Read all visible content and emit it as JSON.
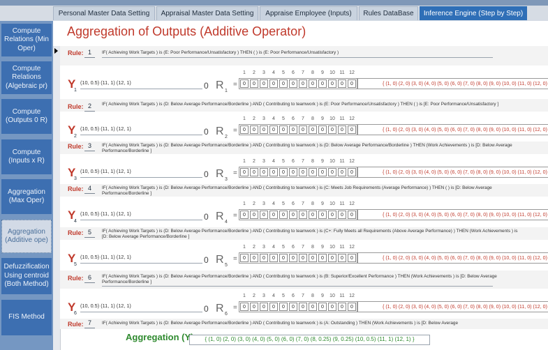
{
  "tabs": [
    {
      "label": "Personal Master Data Setting"
    },
    {
      "label": "Appraisal Master Data Setting"
    },
    {
      "label": "Appraise Employee (Inputs)"
    },
    {
      "label": "Rules DataBase"
    },
    {
      "label": "Inference Engine (Step by Step)",
      "active": true
    }
  ],
  "sidebar": {
    "items": [
      {
        "label": "Compute Relations (Min Oper)"
      },
      {
        "label": "Compute Relations (Algebraic pr)"
      },
      {
        "label": "Compute (Outputs 0 R)"
      },
      {
        "label": "Compute (Inputs x R)"
      },
      {
        "label": "Aggregation (Max Oper)"
      },
      {
        "label": "Aggregation (Additive ope)",
        "active": true
      },
      {
        "label": "Defuzzification Using centroid (Both Method)"
      },
      {
        "label": "FIS Method"
      }
    ]
  },
  "page": {
    "title": "Aggregation of Outputs (Additive Operator)"
  },
  "labels": {
    "rule_keyword": "Rule:",
    "y_letter": "Y",
    "zero_symbol": "0",
    "r_letter": "R",
    "equals": "=",
    "column_numbers": [
      "1",
      "2",
      "3",
      "4",
      "5",
      "6",
      "7",
      "8",
      "9",
      "10",
      "11",
      "12"
    ]
  },
  "rules": [
    {
      "number": "1",
      "text": "IF( Achieving Work Targets ) is (E: Poor Performance/Unsatisfactory ) THEN ( ) is (E: Poor Performance/Unsatisfactory )"
    },
    {
      "number": "2",
      "text": "IF( Achieving Work Targets ) is (D: Below Average Performance/Borderline ) AND ( Contributing to teamwork ) is (E: Poor Performance/Unsatisfactory ) THEN ( ) is [E: Poor Performance/Unsatisfactory ]"
    },
    {
      "number": "3",
      "text": "IF( Achieving Work Targets ) is (D: Below Average Performance/Borderline ) AND ( Contributing to teamwork ) is (D: Below Average Performance/Borderline ) THEN (Work Achievements ) is [D: Below Average Performance/Borderline ]"
    },
    {
      "number": "4",
      "text": "IF( Achieving Work Targets ) is (D: Below Average Performance/Borderline ) AND ( Contributing to teamwork ) is (C: Meets Job Requirements (Average Performance) ) THEN ( ) is [D: Below Average Performance/Borderline ]"
    },
    {
      "number": "5",
      "text": "IF( Achieving Work Targets ) is (D: Below Average Performance/Borderline ) AND ( Contributing to teamwork ) is (C+: Fully Meets all Requirements (Above Average Performance) ) THEN (Work Achievements ) is [D: Below Average Performance/Borderline ]"
    },
    {
      "number": "6",
      "text": "IF( Achieving Work Targets ) is (D: Below Average Performance/Borderline ) AND ( Contributing to teamwork ) is (B: Superior/Excellent Performance ) THEN (Work Achievements ) is [D: Below Average Performance/Borderline ]"
    },
    {
      "number": "7",
      "text": "IF( Achieving Work Targets ) is (D: Below Average Performance/Borderline ) AND ( Contributing to teamwork ) is (A: Outstanding ) THEN (Work Achievements ) is [D: Below Average"
    }
  ],
  "outputs": [
    {
      "sub": "1",
      "y_set": "(10, 0.5) (11, 1) (12, 1)",
      "r_sub": "1",
      "cells": [
        "0",
        "0",
        "0",
        "0",
        "0",
        "0",
        "0",
        "0",
        "0",
        "0",
        "0",
        "0"
      ],
      "result": "{ (1, 0) (2, 0) (3, 0) (4, 0) (5, 0) (6, 0) (7, 0) (8, 0) (9, 0) (10, 0) (11, 0) (12, 0)"
    },
    {
      "sub": "2",
      "y_set": "(10, 0.5) (11, 1) (12, 1)",
      "r_sub": "2",
      "cells": [
        "0",
        "0",
        "0",
        "0",
        "0",
        "0",
        "0",
        "0",
        "0",
        "0",
        "0",
        "0"
      ],
      "result": "{ (1, 0) (2, 0) (3, 0) (4, 0) (5, 0) (6, 0) (7, 0) (8, 0) (9, 0) (10, 0) (11, 0) (12, 0)"
    },
    {
      "sub": "3",
      "y_set": "(10, 0.5) (11, 1) (12, 1)",
      "r_sub": "3",
      "cells": [
        "0",
        "0",
        "0",
        "0",
        "0",
        "0",
        "0",
        "0",
        "0",
        "0",
        "0",
        "0"
      ],
      "result": "{ (1, 0) (2, 0) (3, 0) (4, 0) (5, 0) (6, 0) (7, 0) (8, 0) (9, 0) (10, 0) (11, 0) (12, 0)"
    },
    {
      "sub": "4",
      "y_set": "(10, 0.5) (11, 1) (12, 1)",
      "r_sub": "4",
      "cells": [
        "0",
        "0",
        "0",
        "0",
        "0",
        "0",
        "0",
        "0",
        "0",
        "0",
        "0",
        "0"
      ],
      "result": "{ (1, 0) (2, 0) (3, 0) (4, 0) (5, 0) (6, 0) (7, 0) (8, 0) (9, 0) (10, 0) (11, 0) (12, 0)"
    },
    {
      "sub": "5",
      "y_set": "(10, 0.5) (11, 1) (12, 1)",
      "r_sub": "5",
      "cells": [
        "0",
        "0",
        "0",
        "0",
        "0",
        "0",
        "0",
        "0",
        "0",
        "0",
        "0",
        "0"
      ],
      "result": "{ (1, 0) (2, 0) (3, 0) (4, 0) (5, 0) (6, 0) (7, 0) (8, 0) (9, 0) (10, 0) (11, 0) (12, 0)"
    },
    {
      "sub": "6",
      "y_set": "(10, 0.5) (11, 1) (12, 1)",
      "r_sub": "6",
      "cells": [
        "0",
        "0",
        "0",
        "0",
        "0",
        "0",
        "0",
        "0",
        "0",
        "0",
        "0",
        "0"
      ],
      "result": "{ (1, 0) (2, 0) (3, 0) (4, 0) (5, 0) (6, 0) (7, 0) (8, 0) (9, 0) (10, 0) (11, 0) (12, 0)"
    }
  ],
  "aggregation": {
    "label": "Aggregation (Y) =",
    "value": "{ (1, 0) (2, 0) (3, 0) (4, 0) (5, 0) (6, 0) (7, 0) (8, 0.25) (9, 0.25) (10, 0.5) (11, 1) (12, 1) }"
  },
  "colors": {
    "accent_red": "#c0392b",
    "active_tab": "#2f6fb7",
    "sidebar_button": "#3d6fb1",
    "aggregation_green": "#2f8a2f"
  }
}
